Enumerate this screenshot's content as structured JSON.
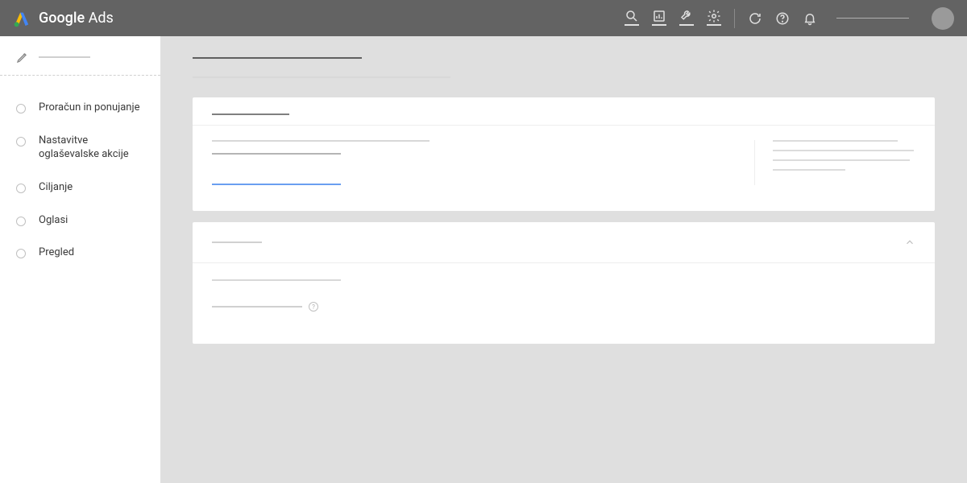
{
  "header": {
    "brand_first": "Google",
    "brand_second": "Ads"
  },
  "sidebar": {
    "items": [
      {
        "label": "Proračun in ponujanje"
      },
      {
        "label": "Nastavitve oglaševalske akcije"
      },
      {
        "label": "Ciljanje"
      },
      {
        "label": "Oglasi"
      },
      {
        "label": "Pregled"
      }
    ]
  }
}
